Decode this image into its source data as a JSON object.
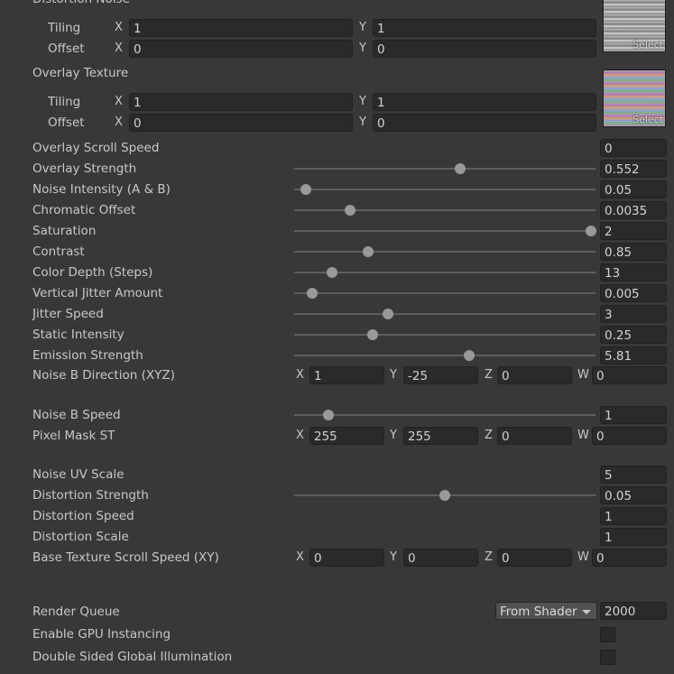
{
  "distortion_noise": {
    "title": "Distortion Noise",
    "tiling_label": "Tiling",
    "offset_label": "Offset",
    "tiling_x": "1",
    "tiling_y": "1",
    "offset_x": "0",
    "offset_y": "0",
    "select_label": "Select"
  },
  "overlay_texture": {
    "title": "Overlay Texture",
    "tiling_label": "Tiling",
    "offset_label": "Offset",
    "tiling_x": "1",
    "tiling_y": "1",
    "offset_x": "0",
    "offset_y": "0",
    "select_label": "Select"
  },
  "axes": {
    "x": "X",
    "y": "Y",
    "z": "Z",
    "w": "W"
  },
  "properties": {
    "overlay_scroll_speed": {
      "label": "Overlay Scroll Speed",
      "value": "0"
    },
    "overlay_strength": {
      "label": "Overlay Strength",
      "value": "0.552",
      "slider_fraction": 0.552
    },
    "noise_intensity": {
      "label": "Noise Intensity (A & B)",
      "value": "0.05",
      "slider_fraction": 0.04
    },
    "chromatic_offset": {
      "label": "Chromatic Offset",
      "value": "0.0035",
      "slider_fraction": 0.185
    },
    "saturation": {
      "label": "Saturation",
      "value": "2",
      "slider_fraction": 0.985
    },
    "contrast": {
      "label": "Contrast",
      "value": "0.85",
      "slider_fraction": 0.245
    },
    "color_depth": {
      "label": "Color Depth (Steps)",
      "value": "13",
      "slider_fraction": 0.125
    },
    "vertical_jitter": {
      "label": "Vertical Jitter Amount",
      "value": "0.005",
      "slider_fraction": 0.06
    },
    "jitter_speed": {
      "label": "Jitter Speed",
      "value": "3",
      "slider_fraction": 0.31
    },
    "static_intensity": {
      "label": "Static Intensity",
      "value": "0.25",
      "slider_fraction": 0.26
    },
    "emission_strength": {
      "label": "Emission Strength",
      "value": "5.81",
      "slider_fraction": 0.58
    },
    "noise_b_direction": {
      "label": "Noise B Direction (XYZ)",
      "x": "1",
      "y": "-25",
      "z": "0",
      "w": "0"
    },
    "noise_b_speed": {
      "label": "Noise B Speed",
      "value": "1",
      "slider_fraction": 0.115
    },
    "pixel_mask_st": {
      "label": "Pixel Mask ST",
      "x": "255",
      "y": "255",
      "z": "0",
      "w": "0"
    },
    "noise_uv_scale": {
      "label": "Noise UV Scale",
      "value": "5"
    },
    "distortion_strength": {
      "label": "Distortion Strength",
      "value": "0.05",
      "slider_fraction": 0.5
    },
    "distortion_speed": {
      "label": "Distortion Speed",
      "value": "1"
    },
    "distortion_scale": {
      "label": "Distortion Scale",
      "value": "1"
    },
    "base_texture_scroll": {
      "label": "Base Texture Scroll Speed (XY)",
      "x": "0",
      "y": "0",
      "z": "0",
      "w": "0"
    }
  },
  "render": {
    "render_queue_label": "Render Queue",
    "render_queue_mode": "From Shader",
    "render_queue_value": "2000",
    "gpu_instancing_label": "Enable GPU Instancing",
    "gpu_instancing_checked": false,
    "double_sided_gi_label": "Double Sided Global Illumination",
    "double_sided_gi_checked": false
  }
}
